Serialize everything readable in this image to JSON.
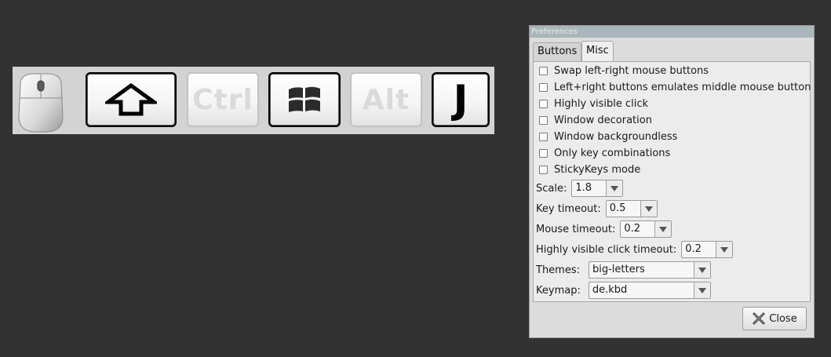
{
  "overlay": {
    "keys": [
      {
        "label": "",
        "icon": "shift-arrow-icon",
        "state": "active"
      },
      {
        "label": "Ctrl",
        "state": "inactive"
      },
      {
        "label": "",
        "icon": "windows-logo-icon",
        "state": "active"
      },
      {
        "label": "Alt",
        "state": "inactive"
      },
      {
        "label": "J",
        "state": "active"
      }
    ],
    "mouse_icon": "mouse-icon"
  },
  "dialog": {
    "title": "Preferences",
    "tabs": [
      {
        "label": "Buttons",
        "selected": false
      },
      {
        "label": "Misc",
        "selected": true
      }
    ],
    "checkboxes": [
      {
        "label": "Swap left-right mouse buttons",
        "checked": false
      },
      {
        "label": "Left+right buttons emulates middle mouse button",
        "checked": false
      },
      {
        "label": "Highly visible click",
        "checked": false
      },
      {
        "label": "Window decoration",
        "checked": false
      },
      {
        "label": "Window backgroundless",
        "checked": false
      },
      {
        "label": "Only key combinations",
        "checked": false
      },
      {
        "label": "StickyKeys mode",
        "checked": false
      }
    ],
    "fields": {
      "scale": {
        "label": "Scale:",
        "value": "1.8"
      },
      "key_timeout": {
        "label": "Key timeout:",
        "value": "0.5"
      },
      "mouse_timeout": {
        "label": "Mouse timeout:",
        "value": "0.2"
      },
      "click_timeout": {
        "label": "Highly visible click timeout:",
        "value": "0.2"
      },
      "themes": {
        "label": "Themes:",
        "value": "big-letters"
      },
      "keymap": {
        "label": "Keymap:",
        "value": "de.kbd"
      }
    },
    "close_label": "Close",
    "close_icon": "close-x-icon"
  },
  "colors": {
    "desktop": "#323232",
    "keybar": "#d3d3d3",
    "titlebar": "#a9b6ba"
  }
}
